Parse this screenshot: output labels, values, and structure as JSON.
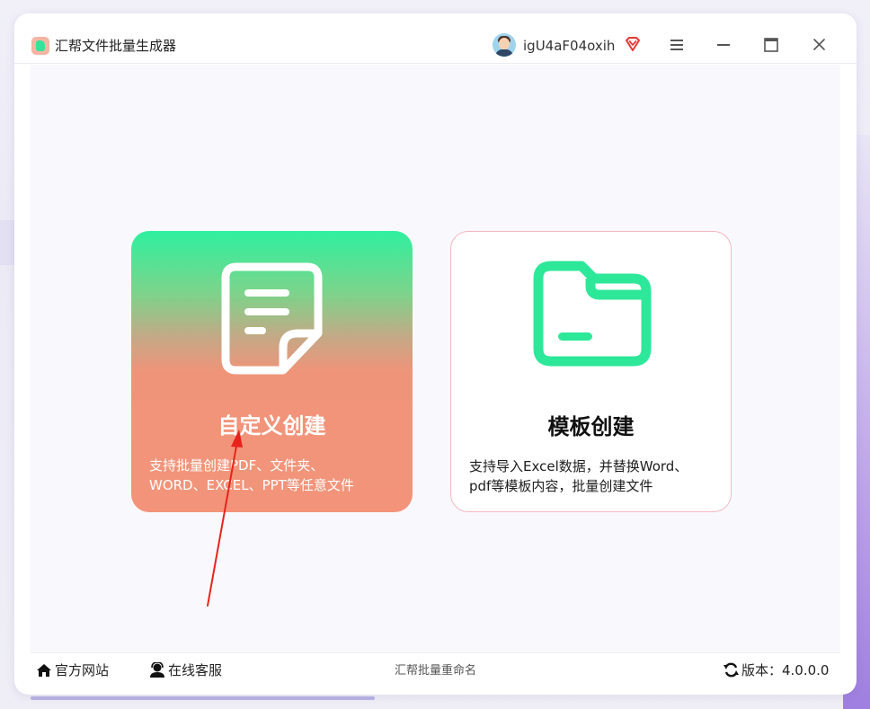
{
  "app": {
    "title": "汇帮文件批量生成器",
    "username": "igU4aF04oxih"
  },
  "cards": [
    {
      "title": "自定义创建",
      "desc_line1": "支持批量创建PDF、文件夹、",
      "desc_line2": "WORD、EXCEL、PPT等任意文件",
      "icon": "document-icon"
    },
    {
      "title": "模板创建",
      "desc_line1": "支持导入Excel数据，并替换Word、",
      "desc_line2": "pdf等模板内容，批量创建文件",
      "icon": "folder-icon"
    }
  ],
  "footer": {
    "website_label": "官方网站",
    "support_label": "在线客服",
    "center_text": "汇帮批量重命名",
    "version_label": "版本：4.0.0.0"
  },
  "colors": {
    "accent_green": "#2ff09f",
    "accent_salmon": "#f3947a",
    "card_border_pink": "#f3b7c2",
    "vip_red": "#e53935",
    "arrow_red": "#e8231c"
  }
}
